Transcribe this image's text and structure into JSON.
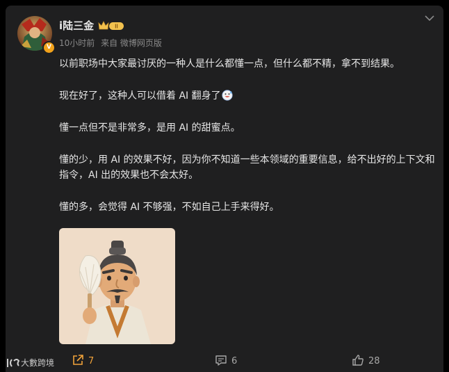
{
  "post": {
    "author": {
      "name": "i陆三金",
      "verified_badge": "V",
      "level_badge": "II"
    },
    "meta": {
      "time": "10小时前",
      "source": "来自 微博网页版"
    },
    "paragraphs": [
      "以前职场中大家最讨厌的一种人是什么都懂一点，但什么都不精，拿不到结果。",
      "现在好了，这种人可以借着 AI 翻身了",
      "懂一点但不是非常多，是用 AI 的甜蜜点。",
      "懂的少，用 AI 的效果不好，因为你不知道一些本领域的重要信息，给不出好的上下文和指令，AI 出的效果也不会太好。",
      "懂的多，会觉得 AI 不够强，不如自己上手来得好。"
    ],
    "image_alt": "",
    "actions": {
      "share_count": "7",
      "comment_count": "6",
      "like_count": "28"
    }
  },
  "watermark": {
    "text": "大數跨境"
  },
  "colors": {
    "background": "#1f1f20",
    "text": "#e6e6e6",
    "meta": "#8a8a8a",
    "accent_orange": "#f0a23a"
  },
  "icons": [
    "expand-chevron-icon",
    "crown-badge-icon",
    "verified-badge-icon",
    "grin-emoji-icon",
    "share-icon",
    "comment-icon",
    "like-icon",
    "watermark-logo-icon"
  ]
}
